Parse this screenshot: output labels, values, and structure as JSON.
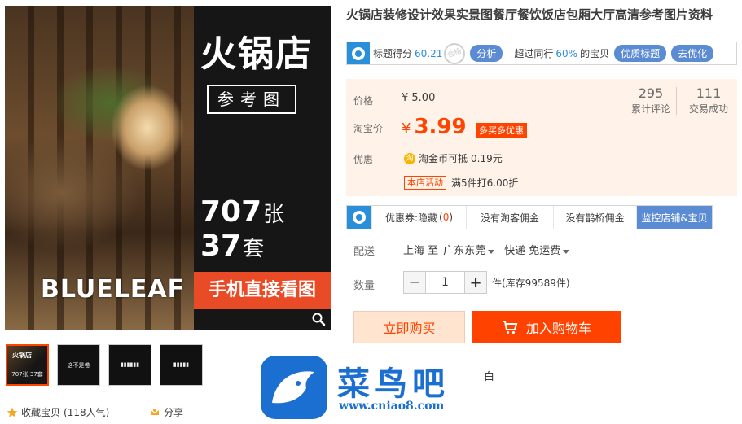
{
  "gallery": {
    "main_title": "火锅店",
    "reference_label": "参考图",
    "photo_count": "707",
    "photo_unit": "张",
    "set_count": "37",
    "set_unit": "套",
    "brand": "BLUELEAF",
    "mobile_label": "手机直接看图",
    "thumbnails": [
      {
        "line1": "火锅店",
        "line2": "707张 37套"
      },
      {
        "line1": "",
        "line2": "这不是卷"
      },
      {
        "line1": "",
        "line2": "▮▮▮▮▮▮"
      },
      {
        "line1": "",
        "line2": "▮▮▮▮▮"
      }
    ],
    "collect_label": "收藏宝贝",
    "collect_count": "(118人气)",
    "share_label": "分享"
  },
  "product": {
    "title": "火锅店装修设计效果实景图餐厅餐饮饭店包厢大厅高清参考图片资料"
  },
  "score_bar": {
    "score_label": "标题得分",
    "score_value": "60.21",
    "stamp": "合格",
    "analyze_btn": "分析",
    "beyond_prefix": "超过同行",
    "beyond_pct": "60%",
    "beyond_suffix": "的宝贝",
    "quality_btn": "优质标题",
    "optimize_btn": "去优化"
  },
  "price": {
    "price_label": "价格",
    "old_price": "¥ 5.00",
    "taobao_label": "淘宝价",
    "currency": "¥",
    "new_price": "3.99",
    "promo_tag": "多买多优惠",
    "reviews_count": "295",
    "reviews_label": "累计评论",
    "deals_count": "111",
    "deals_label": "交易成功",
    "discount_label": "优惠",
    "coin_icon": "淘",
    "coin_text": "淘金币可抵",
    "coin_value": "0.19元",
    "activity_tag": "本店活动",
    "activity_text": "满5件打6.00折"
  },
  "tabs": {
    "coupon_label": "优惠券:隐藏",
    "coupon_count": "0",
    "items": [
      "没有淘客佣金",
      "没有鹊桥佣金"
    ],
    "monitor_label": "监控店铺&宝贝"
  },
  "shipping": {
    "label": "配送",
    "from": "上海 至",
    "to": "广东东莞",
    "method": "快递 免运费"
  },
  "quantity": {
    "label": "数量",
    "minus": "−",
    "value": "1",
    "plus": "+",
    "stock": "件(库存99589件)"
  },
  "actions": {
    "buy_now": "立即购买",
    "add_cart": "加入购物车",
    "pay_text": "白"
  },
  "watermark": {
    "text": "菜鸟吧",
    "url": "www.cniao8.com"
  },
  "colors": {
    "accent": "#ff4400",
    "blue": "#5b8bd2",
    "price_panel_bg": "#fff2e8"
  }
}
